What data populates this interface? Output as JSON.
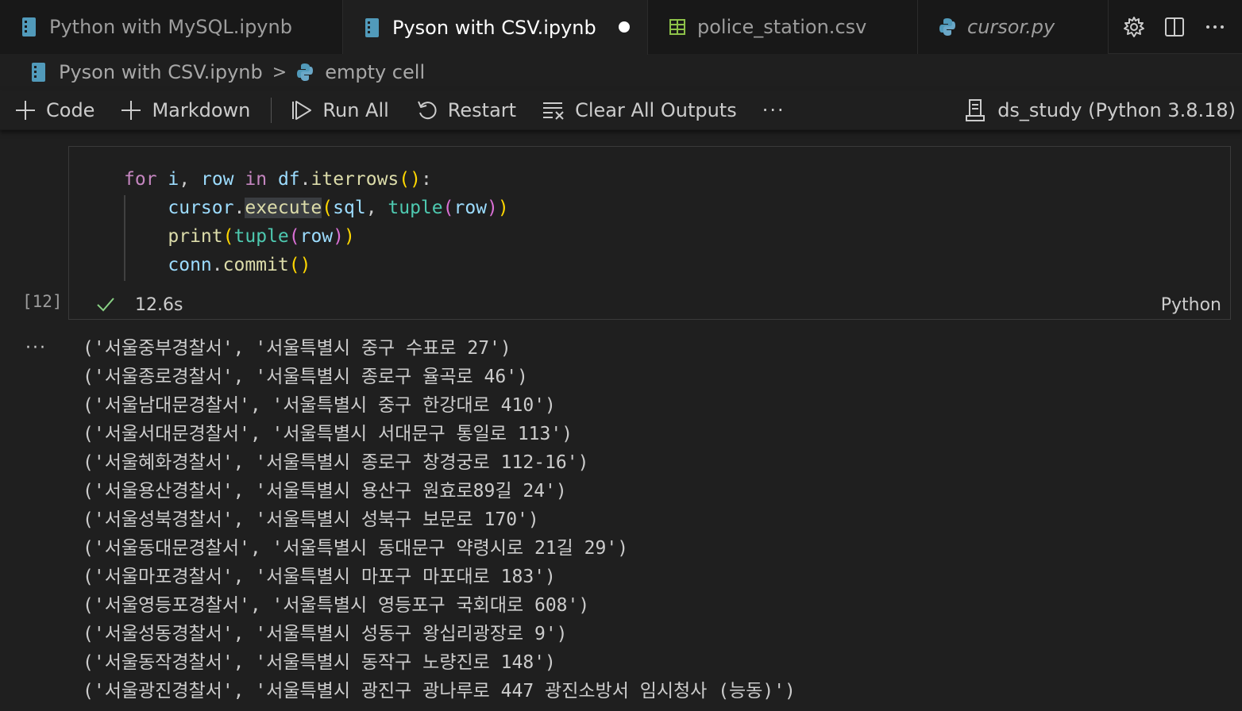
{
  "tabs": [
    {
      "label": "Python with MySQL.ipynb",
      "icon": "notebook-icon",
      "active": false,
      "dirty": false,
      "italic": false
    },
    {
      "label": "Pyson with CSV.ipynb",
      "icon": "notebook-icon",
      "active": true,
      "dirty": true,
      "italic": false
    },
    {
      "label": "police_station.csv",
      "icon": "table-icon",
      "active": false,
      "dirty": false,
      "italic": false
    },
    {
      "label": "cursor.py",
      "icon": "python-icon",
      "active": false,
      "dirty": false,
      "italic": true
    }
  ],
  "breadcrumb": {
    "file": "Pyson with CSV.ipynb",
    "separator": ">",
    "cell": "empty cell"
  },
  "toolbar": {
    "code_label": "Code",
    "markdown_label": "Markdown",
    "run_all_label": "Run All",
    "restart_label": "Restart",
    "clear_outputs_label": "Clear All Outputs",
    "more_label": "···",
    "kernel_label": "ds_study (Python 3.8.18)"
  },
  "cell": {
    "execution_count": "[12]",
    "duration": "12.6s",
    "language": "Python",
    "code_lines": [
      "for i, row in df.iterrows():",
      "    cursor.execute(sql, tuple(row))",
      "    print(tuple(row))",
      "    conn.commit()"
    ]
  },
  "output": {
    "ellipsis": "···",
    "lines": [
      "('서울중부경찰서', '서울특별시 중구 수표로 27')",
      "('서울종로경찰서', '서울특별시 종로구 율곡로 46')",
      "('서울남대문경찰서', '서울특별시 중구 한강대로 410')",
      "('서울서대문경찰서', '서울특별시 서대문구 통일로 113')",
      "('서울혜화경찰서', '서울특별시 종로구 창경궁로 112-16')",
      "('서울용산경찰서', '서울특별시 용산구 원효로89길 24')",
      "('서울성북경찰서', '서울특별시 성북구 보문로 170')",
      "('서울동대문경찰서', '서울특별시 동대문구 약령시로 21길 29')",
      "('서울마포경찰서', '서울특별시 마포구 마포대로 183')",
      "('서울영등포경찰서', '서울특별시 영등포구 국회대로 608')",
      "('서울성동경찰서', '서울특별시 성동구 왕십리광장로 9')",
      "('서울동작경찰서', '서울특별시 동작구 노량진로 148')",
      "('서울광진경찰서', '서울특별시 광진구 광나루로 447 광진소방서 임시청사 (능동)')"
    ]
  },
  "colors": {
    "keyword": "#c586c0",
    "variable": "#9cdcfe",
    "function": "#dcdcaa",
    "builtin": "#4ec9b0",
    "bracket1": "#ffd700",
    "bracket2": "#da70d6",
    "success": "#89d185",
    "notebook_icon": "#519aba",
    "csv_icon": "#8dc149"
  }
}
